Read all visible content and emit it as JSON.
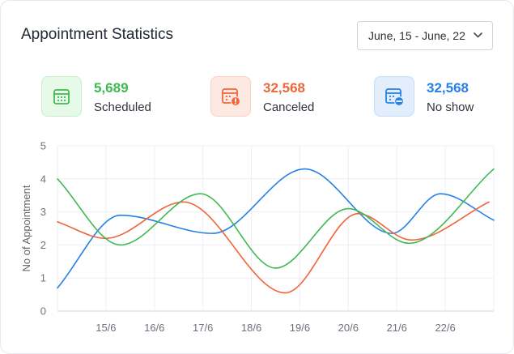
{
  "header": {
    "title": "Appointment Statistics",
    "date_range": "June, 15 - June, 22"
  },
  "stats": [
    {
      "value": "5,689",
      "label": "Scheduled",
      "icon": "calendar-icon",
      "color": "#3fb950",
      "bg": "#e7f9e9",
      "border": "#c5efcb"
    },
    {
      "value": "32,568",
      "label": "Canceled",
      "icon": "calendar-alert-icon",
      "color": "#f0653a",
      "bg": "#fde9e2",
      "border": "#f9d2c5"
    },
    {
      "value": "32,568",
      "label": "No show",
      "icon": "calendar-minus-icon",
      "color": "#2481e8",
      "bg": "#e2eefc",
      "border": "#c6dcf7"
    }
  ],
  "chart_data": {
    "type": "line",
    "ylabel": "No of Appointment",
    "xlabel": "",
    "ylim": [
      0,
      5
    ],
    "yticks": [
      0,
      1,
      2,
      3,
      4,
      5
    ],
    "xlim": [
      14,
      23
    ],
    "x_ticks": [
      {
        "x": 15,
        "label": "15/6"
      },
      {
        "x": 16,
        "label": "16/6"
      },
      {
        "x": 17,
        "label": "17/6"
      },
      {
        "x": 18,
        "label": "18/6"
      },
      {
        "x": 19,
        "label": "19/6"
      },
      {
        "x": 20,
        "label": "20/6"
      },
      {
        "x": 21,
        "label": "21/6"
      },
      {
        "x": 22,
        "label": "22/6"
      }
    ],
    "grid": true,
    "series": [
      {
        "color": "#2481e8",
        "x": [
          14,
          15.3,
          17.2,
          19.1,
          20.9,
          21.9,
          23
        ],
        "values": [
          0.7,
          2.9,
          2.35,
          4.3,
          2.35,
          3.55,
          2.75
        ]
      },
      {
        "color": "#f0653a",
        "x": [
          14,
          15,
          16.6,
          18.7,
          20.2,
          21.3,
          22.9
        ],
        "values": [
          2.7,
          2.2,
          3.3,
          0.55,
          2.95,
          2.15,
          3.3
        ]
      },
      {
        "color": "#3fb950",
        "x": [
          14,
          15.3,
          16.95,
          18.5,
          20,
          21.25,
          23
        ],
        "values": [
          4.0,
          2.0,
          3.55,
          1.3,
          3.1,
          2.05,
          4.3
        ]
      }
    ]
  }
}
